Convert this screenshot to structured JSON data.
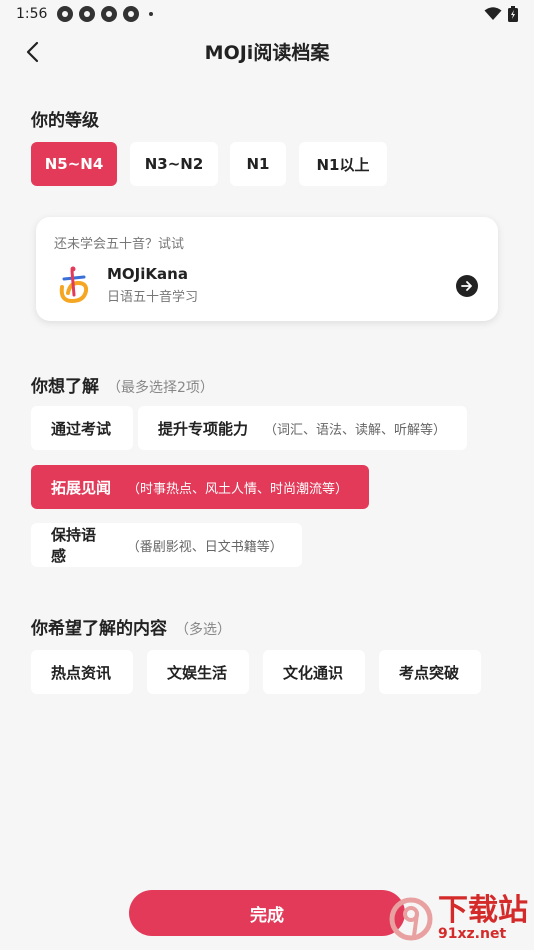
{
  "status_bar": {
    "time": "1:56"
  },
  "header": {
    "title": "MOJi阅读档案"
  },
  "level_section": {
    "title": "你的等级",
    "options": [
      "N5~N4",
      "N3~N2",
      "N1",
      "N1以上"
    ],
    "selected": "N5~N4"
  },
  "kana_card": {
    "hint": "还未学会五十音？试试",
    "app_name": "MOJiKana",
    "app_desc": "日语五十音学习"
  },
  "goal_section": {
    "title": "你想了解",
    "hint": "（最多选择2项）",
    "options": [
      {
        "label": "通过考试",
        "sub": ""
      },
      {
        "label": "提升专项能力",
        "sub": "（词汇、语法、读解、听解等）"
      },
      {
        "label": "拓展见闻",
        "sub": "（时事热点、风土人情、时尚潮流等）"
      },
      {
        "label": "保持语感",
        "sub": "（番剧影视、日文书籍等）"
      }
    ],
    "selected": [
      "拓展见闻"
    ]
  },
  "content_section": {
    "title": "你希望了解的内容",
    "hint": "（多选）",
    "options": [
      "热点资讯",
      "文娱生活",
      "文化通识",
      "考点突破"
    ]
  },
  "footer": {
    "done_label": "完成"
  },
  "watermark": {
    "main": "下载站",
    "sub": "91xz.net"
  },
  "colors": {
    "accent": "#e23a58",
    "background": "#f6f6f6"
  }
}
